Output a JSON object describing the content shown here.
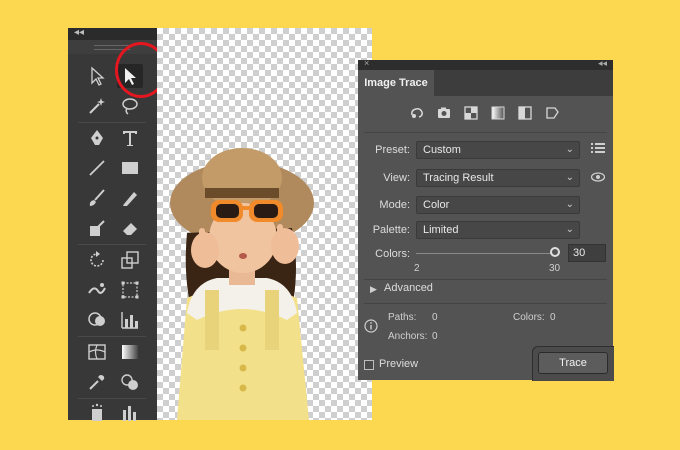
{
  "tools_panel": {
    "collapse_glyph": "◂◂",
    "tools": [
      {
        "name": "selection-tool-icon",
        "active": false
      },
      {
        "name": "direct-selection-tool-icon",
        "active": true
      },
      {
        "name": "magic-wand-icon",
        "active": false
      },
      {
        "name": "lasso-icon",
        "active": false
      },
      {
        "name": "pen-tool-icon",
        "active": false
      },
      {
        "name": "type-tool-icon",
        "active": false
      },
      {
        "name": "line-tool-icon",
        "active": false
      },
      {
        "name": "rectangle-tool-icon",
        "active": false
      },
      {
        "name": "paintbrush-icon",
        "active": false
      },
      {
        "name": "pencil-icon",
        "active": false
      },
      {
        "name": "shaper-tool-icon",
        "active": false
      },
      {
        "name": "eraser-icon",
        "active": false
      },
      {
        "name": "rotate-tool-icon",
        "active": false
      },
      {
        "name": "scale-tool-icon",
        "active": false
      },
      {
        "name": "warp-tool-icon",
        "active": false
      },
      {
        "name": "free-transform-icon",
        "active": false
      },
      {
        "name": "shape-builder-icon",
        "active": false
      },
      {
        "name": "chart-tool-icon",
        "active": false
      },
      {
        "name": "mesh-tool-icon",
        "active": false
      },
      {
        "name": "gradient-tool-icon",
        "active": false
      },
      {
        "name": "eyedropper-icon",
        "active": false
      },
      {
        "name": "blend-tool-icon",
        "active": false
      },
      {
        "name": "symbol-sprayer-icon",
        "active": false
      },
      {
        "name": "column-graph-icon",
        "active": false
      }
    ]
  },
  "image_trace": {
    "panel_close_glyph": "×",
    "panel_collapse_glyph": "◂◂",
    "tab_title": "Image Trace",
    "preset_icons": [
      "auto-color-icon",
      "high-color-icon",
      "low-color-icon",
      "grayscale-icon",
      "black-white-icon",
      "outline-icon"
    ],
    "preset_label": "Preset:",
    "preset_value": "Custom",
    "view_label": "View:",
    "view_value": "Tracing Result",
    "mode_label": "Mode:",
    "mode_value": "Color",
    "palette_label": "Palette:",
    "palette_value": "Limited",
    "colors_label": "Colors:",
    "colors_value": "30",
    "colors_min": "2",
    "colors_max": "30",
    "advanced_label": "Advanced",
    "paths_label": "Paths:",
    "paths_value": "0",
    "colors_count_label": "Colors:",
    "colors_count_value": "0",
    "anchors_label": "Anchors:",
    "anchors_value": "0",
    "preview_label": "Preview",
    "trace_button": "Trace",
    "dropdown_arrow": "⌄"
  },
  "colors": {
    "background": "#fbd84f",
    "panel": "#535353",
    "toolbar": "#383838",
    "highlight": "#e4161f"
  }
}
